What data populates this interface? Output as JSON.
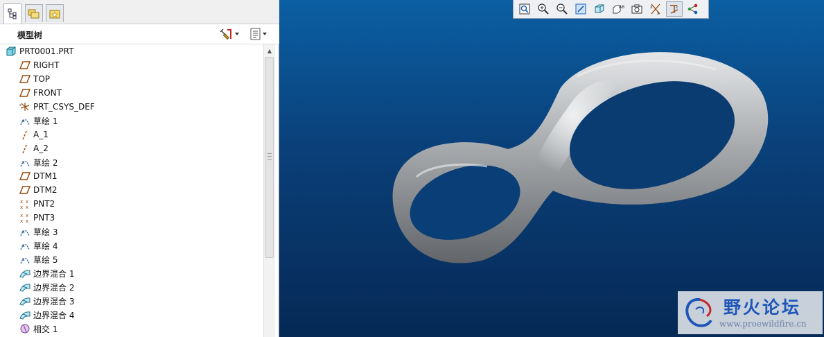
{
  "model_tree": {
    "title": "模型树",
    "items": [
      {
        "label": "PRT0001.PRT",
        "icon": "part-icon"
      },
      {
        "label": "RIGHT",
        "icon": "datum-plane-icon"
      },
      {
        "label": "TOP",
        "icon": "datum-plane-icon"
      },
      {
        "label": "FRONT",
        "icon": "datum-plane-icon"
      },
      {
        "label": "PRT_CSYS_DEF",
        "icon": "coordinate-system-icon"
      },
      {
        "label": "草绘 1",
        "icon": "sketch-icon"
      },
      {
        "label": "A_1",
        "icon": "datum-axis-icon"
      },
      {
        "label": "A_2",
        "icon": "datum-axis-icon"
      },
      {
        "label": "草绘 2",
        "icon": "sketch-icon"
      },
      {
        "label": "DTM1",
        "icon": "datum-plane-icon"
      },
      {
        "label": "DTM2",
        "icon": "datum-plane-icon"
      },
      {
        "label": "PNT2",
        "icon": "datum-point-icon"
      },
      {
        "label": "PNT3",
        "icon": "datum-point-icon"
      },
      {
        "label": "草绘 3",
        "icon": "sketch-icon"
      },
      {
        "label": "草绘 4",
        "icon": "sketch-icon"
      },
      {
        "label": "草绘 5",
        "icon": "sketch-icon"
      },
      {
        "label": "边界混合 1",
        "icon": "boundary-blend-icon"
      },
      {
        "label": "边界混合 2",
        "icon": "boundary-blend-icon"
      },
      {
        "label": "边界混合 3",
        "icon": "boundary-blend-icon"
      },
      {
        "label": "边界混合 4",
        "icon": "boundary-blend-icon"
      },
      {
        "label": "相交 1",
        "icon": "intersect-icon"
      }
    ]
  },
  "watermark": {
    "title": "野火论坛",
    "url": "www.proewildfire.cn"
  }
}
